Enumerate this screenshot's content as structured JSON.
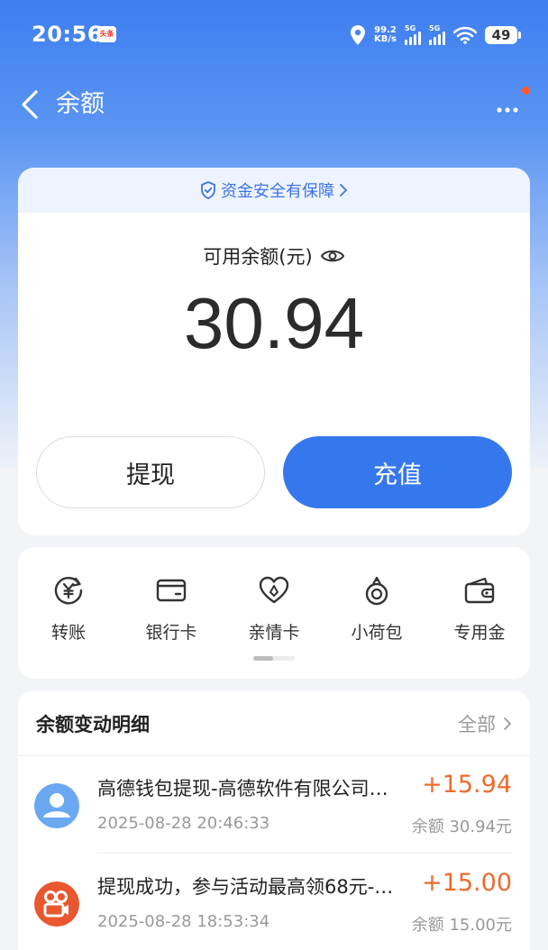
{
  "status_bar": {
    "time": "20:56",
    "notif_badge": "头条",
    "speed_value": "99.2",
    "speed_unit": "KB/s",
    "sim1_label": "5G",
    "sim2_label": "5G",
    "battery": "49"
  },
  "header": {
    "title": "余额"
  },
  "balance_card": {
    "safety_text": "资金安全有保障",
    "balance_label": "可用余额(元)",
    "balance_value": "30.94",
    "withdraw_label": "提现",
    "recharge_label": "充值"
  },
  "features": [
    {
      "label": "转账",
      "icon": "yuan-transfer-icon"
    },
    {
      "label": "银行卡",
      "icon": "bank-card-icon"
    },
    {
      "label": "亲情卡",
      "icon": "family-heart-icon"
    },
    {
      "label": "小荷包",
      "icon": "pouch-icon"
    },
    {
      "label": "专用金",
      "icon": "wallet-icon"
    }
  ],
  "records": {
    "title": "余额变动明细",
    "all_label": "全部",
    "items": [
      {
        "name": "高德钱包提现-高德软件有限公司…",
        "date": "2025-08-28 20:46:33",
        "amount": "+15.94",
        "balance": "余额 30.94元",
        "icon": "user-avatar-icon"
      },
      {
        "name": "提现成功，参与活动最高领68元-…",
        "date": "2025-08-28 18:53:34",
        "amount": "+15.00",
        "balance": "余额 15.00元",
        "icon": "kuaishou-logo-icon"
      }
    ]
  },
  "colors": {
    "primary": "#3578ee",
    "amount_positive": "#f06a2c",
    "header_gradient_top": "#3d7ef0"
  }
}
